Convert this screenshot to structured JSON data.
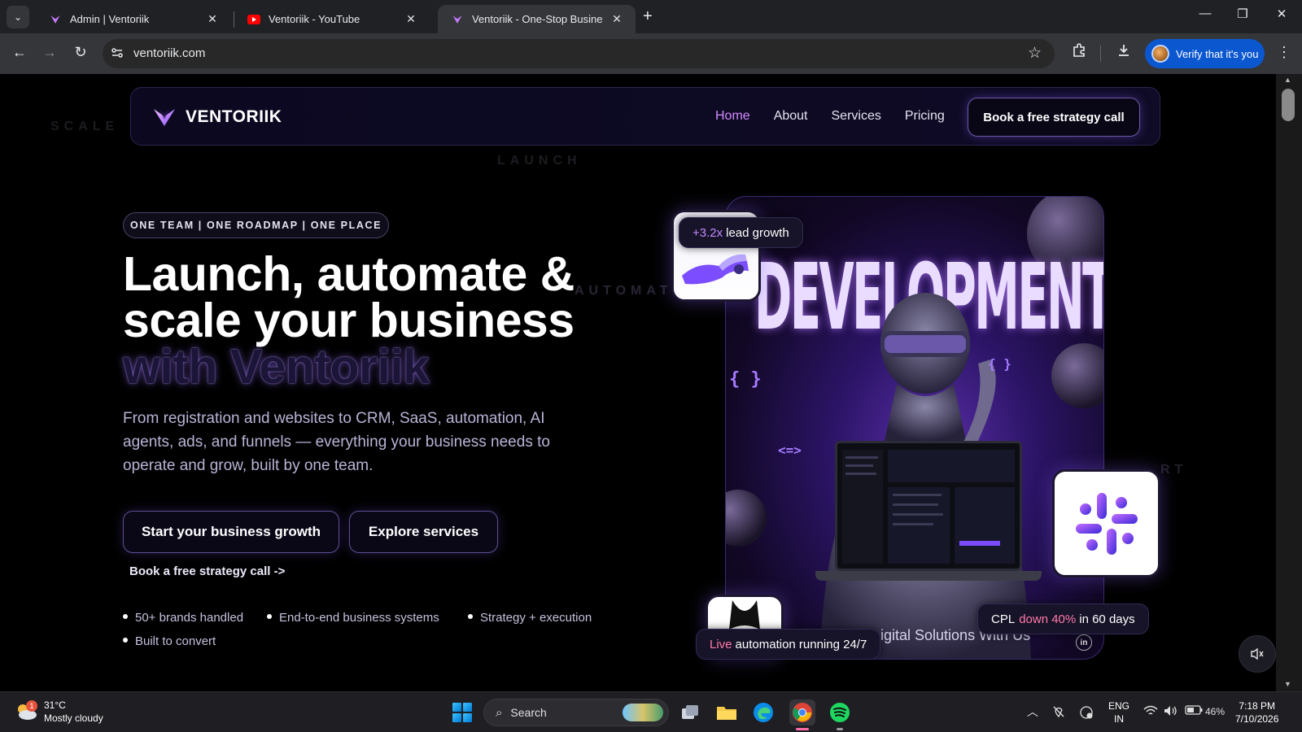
{
  "browser": {
    "tabs": [
      {
        "title": "Admin | Ventoriik",
        "favicon": "ventoriik-logo-icon"
      },
      {
        "title": "Ventoriik - YouTube",
        "favicon": "youtube-icon"
      },
      {
        "title": "Ventoriik - One-Stop Business S",
        "favicon": "ventoriik-logo-icon",
        "active": true
      }
    ],
    "url": "ventoriik.com",
    "verify_label": "Verify that it's you",
    "accent": "#0b57d0"
  },
  "site": {
    "brand": "VENTORIIK",
    "nav": [
      {
        "label": "Home",
        "active": true
      },
      {
        "label": "About"
      },
      {
        "label": "Services"
      },
      {
        "label": "Pricing"
      }
    ],
    "nav_cta": "Book a free strategy call",
    "ghost_words": [
      "SCALE",
      "LAUNCH",
      "AUTOMATE",
      "RT"
    ],
    "eyebrow": "ONE TEAM | ONE ROADMAP | ONE PLACE",
    "headline": {
      "line1": "Launch, automate &",
      "line2": "scale your business",
      "line3": "with Ventoriik"
    },
    "subtext": "From registration and websites to CRM, SaaS, automation, AI agents, ads, and funnels — everything your business needs to operate and grow, built by one team.",
    "primary_button": "Start your business growth",
    "secondary_button": "Explore services",
    "text_link": "Book a free strategy call ->",
    "bullets": [
      "50+ brands handled",
      "End-to-end business systems",
      "Strategy + execution",
      "Built to convert"
    ],
    "hero": {
      "banner_text": "DEVELOPMENT",
      "tagline": "igital Solutions With Us",
      "linkedin": "in",
      "brace_left": "{ }",
      "brace_right": "{ }",
      "arrows": "<=>"
    },
    "badges": {
      "lead": {
        "highlight": "+3.2x",
        "text": "lead growth"
      },
      "cpl": {
        "prefix": "CPL",
        "highlight": "down 40%",
        "text": "in 60 days"
      },
      "live": {
        "highlight": "Live",
        "text": "automation running 24/7"
      }
    },
    "accent_purple": "#d48bff",
    "accent_pink": "#ff7aa8"
  },
  "taskbar": {
    "weather": {
      "temp": "31°C",
      "condition": "Mostly cloudy",
      "notifications": "1"
    },
    "search_placeholder": "Search",
    "language": "ENG",
    "region": "IN",
    "battery": "46%",
    "time": "7:18 PM",
    "date": "7/10/2026"
  }
}
